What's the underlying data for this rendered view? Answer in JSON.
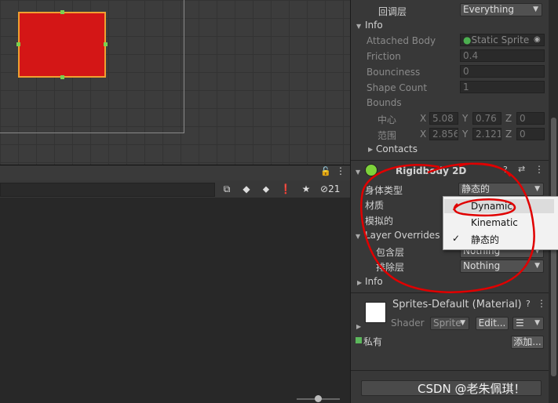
{
  "colors": {
    "accent_red": "#e01010",
    "sprite_fill": "#d41616",
    "sprite_outline": "#f0a030",
    "scribble": "#e00000"
  },
  "toolbar": {
    "hidden_count": "21"
  },
  "inspector": {
    "collision_layers": {
      "label": "回调层",
      "value": "Everything"
    },
    "info": {
      "header": "Info",
      "attached_body_label": "Attached Body",
      "attached_body_value": "Static Sprite",
      "friction_label": "Friction",
      "friction_value": "0.4",
      "bounciness_label": "Bounciness",
      "bounciness_value": "0",
      "shape_count_label": "Shape Count",
      "shape_count_value": "1",
      "bounds_label": "Bounds",
      "center_label": "中心",
      "extent_label": "范围",
      "center": {
        "x": "5.08",
        "y": "0.76",
        "z": "0"
      },
      "extent": {
        "x": "2.856",
        "y": "2.121",
        "z": "0"
      },
      "axis_x": "X",
      "axis_y": "Y",
      "axis_z": "Z"
    },
    "contacts_label": "Contacts",
    "rigidbody": {
      "title": "Rigidbody 2D",
      "body_type_label": "身体类型",
      "body_type_value": "静态的",
      "material_label": "材质",
      "simulated_label": "模拟的"
    },
    "layer_overrides": {
      "header": "Layer Overrides",
      "include_label": "包含层",
      "include_value": "Nothing",
      "exclude_label": "排除层",
      "exclude_value": "Nothing"
    },
    "info2_header": "Info",
    "material": {
      "title": "Sprites-Default (Material)",
      "shader_label": "Shader",
      "shader_value": "Sprite",
      "edit_label": "Edit..."
    },
    "private_label": "私有",
    "add_label": "添加..."
  },
  "popup": {
    "items": [
      {
        "label": "Dynamic",
        "checked": false
      },
      {
        "label": "Kinematic",
        "checked": false
      },
      {
        "label": "静态的",
        "checked": true
      }
    ],
    "check_glyph": "✓"
  },
  "watermark": "CSDN @老朱佩琪！"
}
